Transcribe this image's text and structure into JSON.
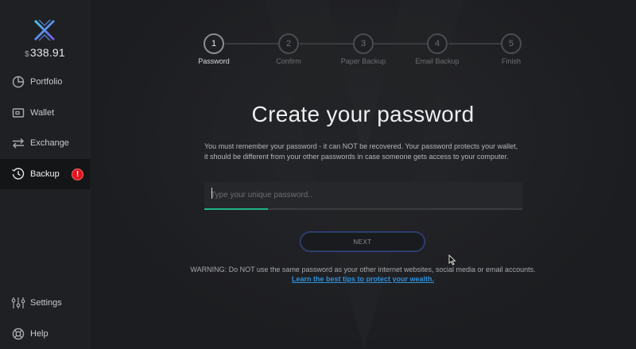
{
  "sidebar": {
    "balance_currency": "$",
    "balance_amount": "338.91",
    "items": [
      {
        "label": "Portfolio",
        "icon": "pie-chart-icon"
      },
      {
        "label": "Wallet",
        "icon": "wallet-icon"
      },
      {
        "label": "Exchange",
        "icon": "exchange-arrows-icon"
      },
      {
        "label": "Backup",
        "icon": "backup-clock-icon",
        "active": true,
        "badge": "!"
      },
      {
        "label": "Settings",
        "icon": "sliders-icon"
      },
      {
        "label": "Help",
        "icon": "lifebuoy-icon"
      }
    ]
  },
  "steps": [
    {
      "number": "1",
      "label": "Password",
      "active": true
    },
    {
      "number": "2",
      "label": "Confirm"
    },
    {
      "number": "3",
      "label": "Paper Backup"
    },
    {
      "number": "4",
      "label": "Email Backup"
    },
    {
      "number": "5",
      "label": "Finish"
    }
  ],
  "content": {
    "title": "Create your password",
    "description": "You must remember your password - it can NOT be recovered. Your password protects your wallet, it should be different from your other passwords in case someone gets access to your computer.",
    "password_placeholder": "Type your unique password..",
    "password_value": "",
    "strength_fraction": 0.2,
    "next_label": "NEXT",
    "warning": "WARNING: Do NOT use the same password as your other internet websites, social media or email accounts.",
    "learn_link": "Learn the best tips to protect your wealth."
  },
  "colors": {
    "accent_green": "#1fb589",
    "alert_red": "#e0141e",
    "link_blue": "#2f8fd8",
    "logo_blue": "#3a6ff0",
    "logo_purple": "#8a5cf0"
  }
}
